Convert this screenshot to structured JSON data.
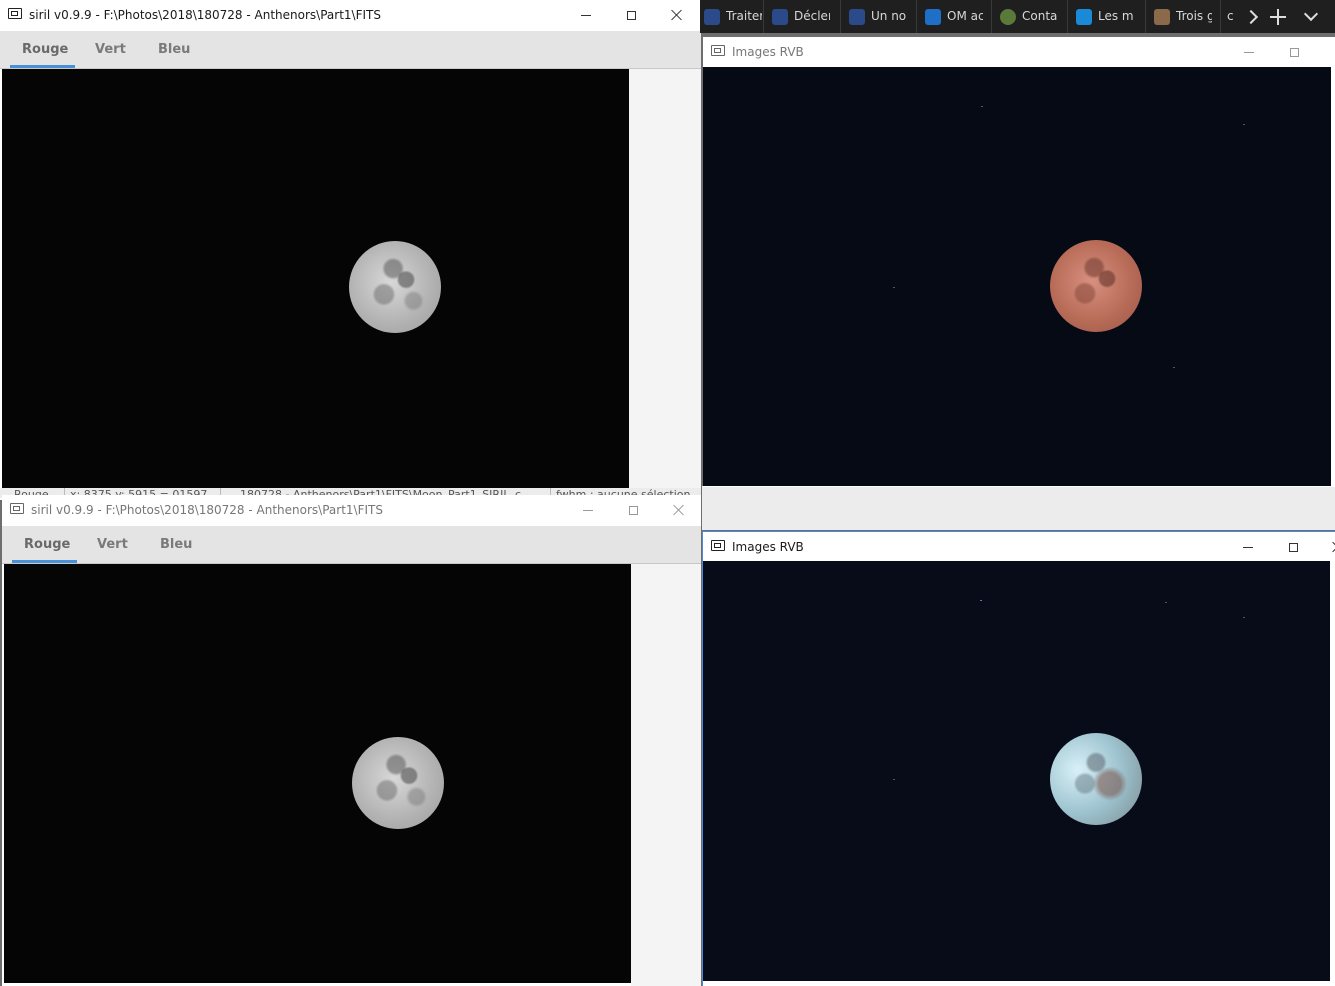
{
  "siril_top": {
    "title": "siril v0.9.9 - F:\\Photos\\2018\\180728 - Anthenors\\Part1\\FITS",
    "tabs": [
      "Rouge",
      "Vert",
      "Bleu"
    ],
    "active_tab": "Rouge",
    "statusbar": {
      "channel": "Rouge",
      "coords": "x: 8375 y: 5915 = 01597",
      "path": "180728 - Anthenors\\Part1\\FITS\\Moon_Part1_SIRIL_c",
      "fwhm": "fwhm : aucune sélection"
    }
  },
  "siril_bottom": {
    "title": "siril v0.9.9 - F:\\Photos\\2018\\180728 - Anthenors\\Part1\\FITS",
    "tabs": [
      "Rouge",
      "Vert",
      "Bleu"
    ],
    "active_tab": "Rouge"
  },
  "rgb_top": {
    "title": "Images RVB"
  },
  "rgb_bottom": {
    "title": "Images RVB"
  },
  "browser_tabs": [
    {
      "label": "Traiter",
      "icon": "astro-icon",
      "color": "#2a4a8a"
    },
    {
      "label": "Déclen",
      "icon": "astro-icon",
      "color": "#2a4a8a"
    },
    {
      "label": "Un no",
      "icon": "astro-icon",
      "color": "#2a4a8a"
    },
    {
      "label": "OM ac",
      "icon": "om-icon",
      "color": "#1e6fc8"
    },
    {
      "label": "Conta",
      "icon": "ballot-icon",
      "color": "#5a7a3a"
    },
    {
      "label": "Les m",
      "icon": "c-icon",
      "color": "#1a8ad8"
    },
    {
      "label": "Trois g",
      "icon": "picture-icon",
      "color": "#8a6a4a"
    },
    {
      "label": "c",
      "icon": "",
      "color": ""
    }
  ]
}
